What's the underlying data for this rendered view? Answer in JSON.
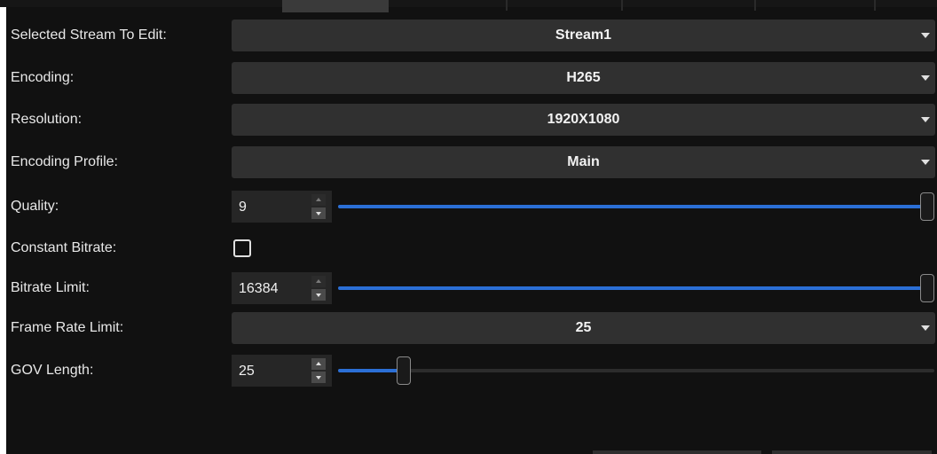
{
  "fields": {
    "stream": {
      "label": "Selected Stream To Edit:",
      "value": "Stream1"
    },
    "encoding": {
      "label": "Encoding:",
      "value": "H265"
    },
    "resolution": {
      "label": "Resolution:",
      "value": "1920X1080"
    },
    "profile": {
      "label": "Encoding Profile:",
      "value": "Main"
    },
    "quality": {
      "label": "Quality:",
      "value": "9",
      "slider_fraction": 1.0
    },
    "cbr": {
      "label": "Constant Bitrate:",
      "checked": false
    },
    "bitrate": {
      "label": "Bitrate Limit:",
      "value": "16384",
      "slider_fraction": 1.0
    },
    "framerate": {
      "label": "Frame Rate Limit:",
      "value": "25"
    },
    "gov": {
      "label": "GOV Length:",
      "value": "25",
      "slider_fraction": 0.1
    }
  },
  "colors": {
    "accent": "#2b6fd6",
    "background": "#111111",
    "control": "#303030"
  },
  "icons": {
    "dropdown": "chevron-down-icon",
    "spin_up": "spin-up-icon",
    "spin_down": "spin-down-icon"
  }
}
